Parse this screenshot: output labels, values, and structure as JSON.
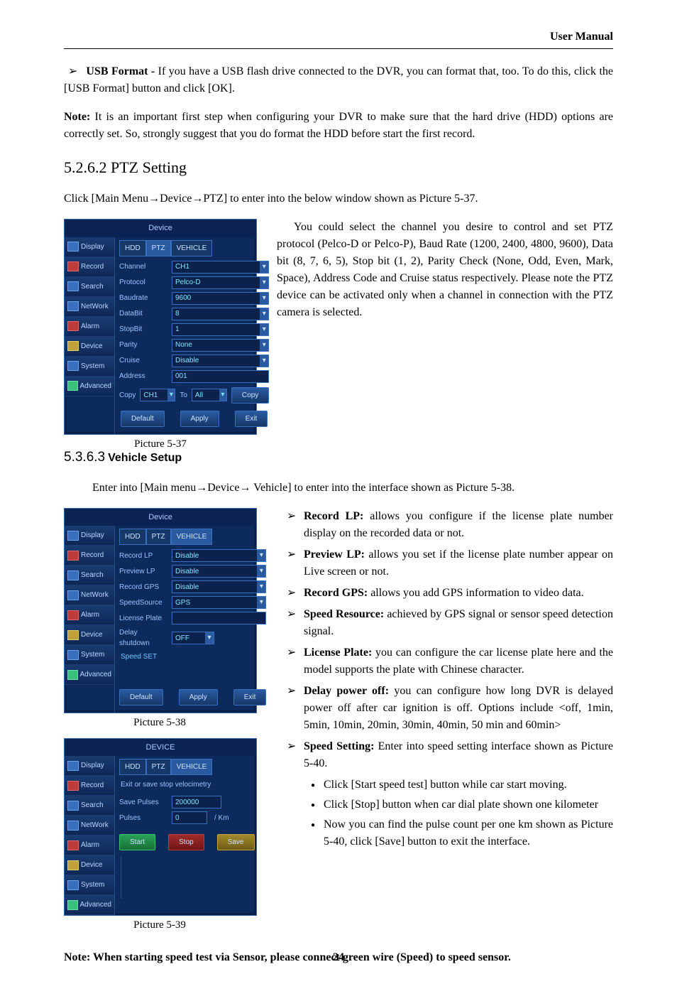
{
  "header": {
    "title": "User Manual"
  },
  "page_number": "24",
  "section_top": {
    "bullet_title": "USB Format -",
    "bullet_body": " If you have a USB flash drive connected to the DVR, you can format that, too. To do this, click the [USB Format] button and click [OK].",
    "note_label": "Note:",
    "note_body": " It is an important first step when configuring your DVR to make sure that the hard drive (HDD) options are correctly set. So, strongly suggest that you do format the HDD before start the first record."
  },
  "s1": {
    "num": "5.2.6.2",
    "title": "PTZ Setting",
    "intro_a": "Click [Main Menu",
    "intro_b": "Device",
    "intro_c": "PTZ] to enter into the below window shown as Picture 5-37.",
    "caption": "Picture 5-37",
    "body": "You could select the channel you desire to control and set PTZ protocol (Pelco-D or Pelco-P), Baud Rate (1200, 2400, 4800, 9600), Data bit (8, 7, 6, 5), Stop bit (1, 2), Parity Check (None, Odd, Even, Mark, Space), Address Code and Cruise status respectively. Please note the PTZ device can be activated only when a channel in connection with the PTZ camera is selected."
  },
  "s2": {
    "num": "5.3.6.3",
    "title": "Vehicle Setup",
    "intro_a": "Enter into [Main menu",
    "intro_b": "Device",
    "intro_c": " Vehicle] to enter into the interface shown as Picture 5-38.",
    "cap38": "Picture 5-38",
    "cap39": "Picture 5-39",
    "items": {
      "record_lp_t": "Record LP:",
      "record_lp": " allows you configure if the license plate number display on the recorded data or not.",
      "preview_lp_t": "Preview LP:",
      "preview_lp": " allows you set if the license plate number appear on Live screen or not.",
      "record_gps_t": "Record GPS:",
      "record_gps": " allows you add GPS information to video data.",
      "speed_res_t": "Speed Resource:",
      "speed_res": " achieved by GPS signal or sensor speed detection signal.",
      "license_t": "License Plate:",
      "license": " you can configure the car license plate here and the model supports the plate with Chinese character.",
      "delay_t": "Delay power off:",
      "delay": " you can configure how long DVR is delayed power off after car ignition is off. Options include <off, 1min, 5min, 10min, 20min, 30min, 40min, 50 min and 60min>",
      "speedset_t": "Speed Setting:",
      "speedset": " Enter into speed setting interface shown as Picture 5-40.",
      "sub1": "Click [Start speed test] button while car start moving.",
      "sub2": "Click [Stop] button when car dial plate shown one kilometer",
      "sub3": "Now you can find the pulse count per one km shown as Picture 5-40, click [Save] button to exit the interface."
    },
    "final_note": "Note: When starting speed test via Sensor, please connect green wire (Speed) to speed sensor."
  },
  "arrow": "→",
  "dvr_common": {
    "nav": [
      "Display",
      "Record",
      "Search",
      "NetWork",
      "Alarm",
      "Device",
      "System",
      "Advanced"
    ],
    "tabs": [
      "HDD",
      "PTZ",
      "VEHICLE"
    ],
    "btn_default": "Default",
    "btn_apply": "Apply",
    "btn_exit": "Exit"
  },
  "dvr37": {
    "title": "Device",
    "active_tab": 1,
    "fields": [
      {
        "label": "Channel",
        "value": "CH1",
        "dd": true
      },
      {
        "label": "Protocol",
        "value": "Pelco-D",
        "dd": true
      },
      {
        "label": "Baudrate",
        "value": "9600",
        "dd": true
      },
      {
        "label": "DataBit",
        "value": "8",
        "dd": true
      },
      {
        "label": "StopBit",
        "value": "1",
        "dd": true
      },
      {
        "label": "Parity",
        "value": "None",
        "dd": true
      },
      {
        "label": "Cruise",
        "value": "Disable",
        "dd": true
      },
      {
        "label": "Address",
        "value": "001",
        "dd": false
      }
    ],
    "copy_label": "Copy",
    "copy_from": "CH1",
    "to_label": "To",
    "copy_to": "All",
    "copy_btn": "Copy"
  },
  "dvr38": {
    "title": "Device",
    "active_tab": 2,
    "fields": [
      {
        "label": "Record LP",
        "value": "Disable",
        "dd": true
      },
      {
        "label": "Preview LP",
        "value": "Disable",
        "dd": true
      },
      {
        "label": "Record GPS",
        "value": "Disable",
        "dd": true
      },
      {
        "label": "SpeedSource",
        "value": "GPS",
        "dd": true
      },
      {
        "label": "License Plate",
        "value": "",
        "dd": false
      },
      {
        "label": "Delay shutdown",
        "value": "OFF",
        "dd": true
      }
    ],
    "speed_set": "Speed SET"
  },
  "dvr39": {
    "title": "DEVICE",
    "active_tab": 2,
    "hint": "Exit or save stop velocimetry",
    "save_pulses_label": "Save Pulses",
    "save_pulses_value": "200000",
    "pulses_label": "Pulses",
    "pulses_value": "0",
    "pulses_unit": "/ Km",
    "btn_start": "Start",
    "btn_stop": "Stop",
    "btn_save": "Save"
  }
}
